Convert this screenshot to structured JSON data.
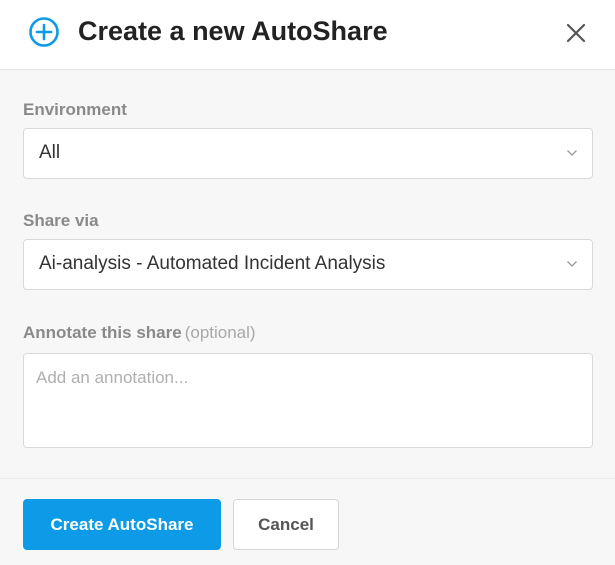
{
  "header": {
    "title": "Create a new AutoShare",
    "icon": "plus-circle-icon",
    "close_icon": "close-icon"
  },
  "form": {
    "environment": {
      "label": "Environment",
      "selected": "All"
    },
    "share_via": {
      "label": "Share via",
      "selected": "Ai-analysis - Automated Incident Analysis"
    },
    "annotation": {
      "label": "Annotate this share",
      "optional": "(optional)",
      "placeholder": "Add an annotation...",
      "value": ""
    }
  },
  "footer": {
    "primary_label": "Create AutoShare",
    "secondary_label": "Cancel"
  },
  "colors": {
    "accent": "#0d9be8",
    "label": "#8a8a8a",
    "title": "#222222"
  }
}
